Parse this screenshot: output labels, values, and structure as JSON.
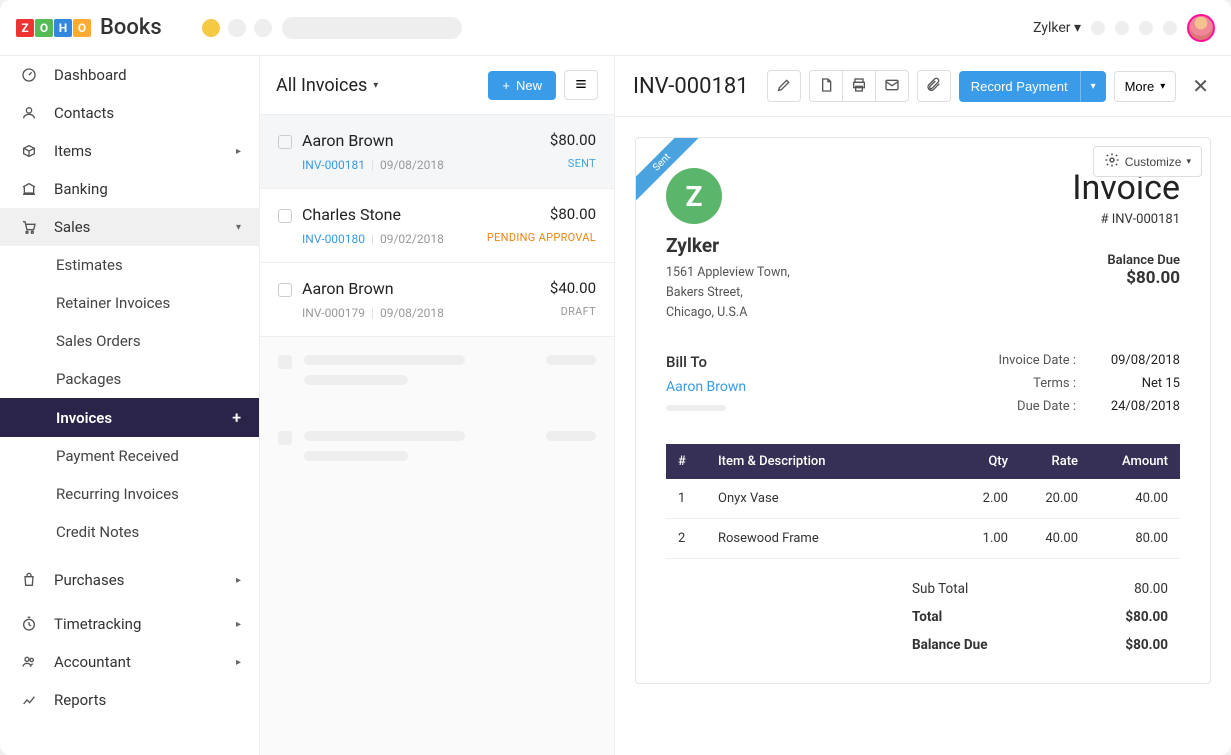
{
  "topbar": {
    "brand_suffix": "Books",
    "org_name": "Zylker"
  },
  "sidebar": {
    "items": [
      {
        "label": "Dashboard",
        "icon": "dashboard"
      },
      {
        "label": "Contacts",
        "icon": "contacts"
      },
      {
        "label": "Items",
        "icon": "items",
        "chevron": true
      },
      {
        "label": "Banking",
        "icon": "banking"
      },
      {
        "label": "Sales",
        "icon": "sales",
        "chevron": true,
        "expanded": true
      },
      {
        "label": "Purchases",
        "icon": "purchases",
        "chevron": true
      },
      {
        "label": "Timetracking",
        "icon": "time",
        "chevron": true
      },
      {
        "label": "Accountant",
        "icon": "accountant",
        "chevron": true
      },
      {
        "label": "Reports",
        "icon": "reports"
      }
    ],
    "sales_sub": [
      {
        "label": "Estimates"
      },
      {
        "label": "Retainer Invoices"
      },
      {
        "label": "Sales Orders"
      },
      {
        "label": "Packages"
      },
      {
        "label": "Invoices",
        "active": true
      },
      {
        "label": "Payment Received"
      },
      {
        "label": "Recurring Invoices"
      },
      {
        "label": "Credit Notes"
      }
    ]
  },
  "list": {
    "title": "All Invoices",
    "new_label": "New",
    "rows": [
      {
        "name": "Aaron Brown",
        "num": "INV-000181",
        "date": "09/08/2018",
        "amount": "$80.00",
        "status": "SENT",
        "selected": true,
        "num_blue": true
      },
      {
        "name": "Charles Stone",
        "num": "INV-000180",
        "date": "09/02/2018",
        "amount": "$80.00",
        "status": "PENDING APPROVAL",
        "num_blue": true
      },
      {
        "name": "Aaron Brown",
        "num": "INV-000179",
        "date": "09/08/2018",
        "amount": "$40.00",
        "status": "DRAFT",
        "num_blue": false
      }
    ]
  },
  "detail": {
    "title": "INV-000181",
    "record_payment": "Record Payment",
    "more": "More",
    "customize": "Customize",
    "ribbon": "Sent",
    "company": {
      "logo_letter": "Z",
      "name": "Zylker",
      "addr1": "1561 Appleview Town,",
      "addr2": "Bakers Street,",
      "addr3": "Chicago, U.S.A"
    },
    "invoice_label": "Invoice",
    "invoice_num": "# INV-000181",
    "balance_due_label": "Balance Due",
    "balance_due": "$80.00",
    "bill_to_label": "Bill To",
    "bill_to_name": "Aaron Brown",
    "meta": [
      {
        "label": "Invoice Date :",
        "value": "09/08/2018"
      },
      {
        "label": "Terms :",
        "value": "Net 15"
      },
      {
        "label": "Due Date :",
        "value": "24/08/2018"
      }
    ],
    "columns": {
      "hash": "#",
      "item": "Item & Description",
      "qty": "Qty",
      "rate": "Rate",
      "amount": "Amount"
    },
    "line_items": [
      {
        "n": "1",
        "desc": "Onyx Vase",
        "qty": "2.00",
        "rate": "20.00",
        "amount": "40.00"
      },
      {
        "n": "2",
        "desc": "Rosewood Frame",
        "qty": "1.00",
        "rate": "40.00",
        "amount": "80.00"
      }
    ],
    "totals": [
      {
        "label": "Sub Total",
        "value": "80.00"
      },
      {
        "label": "Total",
        "value": "$80.00",
        "strong": true
      },
      {
        "label": "Balance Due",
        "value": "$80.00",
        "strong": true
      }
    ]
  }
}
